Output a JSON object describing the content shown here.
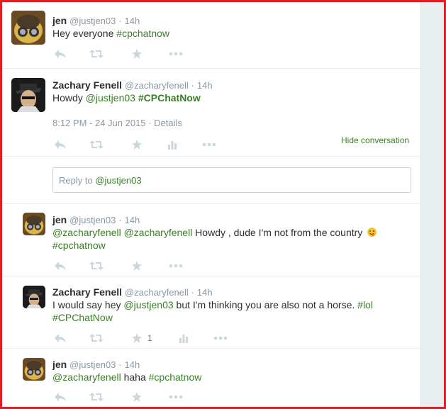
{
  "tweets": [
    {
      "name": "jen",
      "handle": "@justjen03",
      "time": "14h",
      "text_plain": "Hey everyone ",
      "hashtag": "#cpchatnow"
    },
    {
      "name": "Zachary Fenell",
      "handle": "@zacharyfenell",
      "time": "14h",
      "text_plain": "Howdy ",
      "mention": "@justjen03",
      "hashtag": "#CPChatNow",
      "timestamp": "8:12 PM - 24 Jun 2015",
      "details": "Details",
      "hide_conversation": "Hide conversation"
    },
    {
      "name": "jen",
      "handle": "@justjen03",
      "time": "14h",
      "mention1": "@zacharyfenell",
      "mention2": "@zacharyfenell",
      "text_plain": " Howdy , dude I'm not from the country ",
      "hashtag": "#cpchatnow"
    },
    {
      "name": "Zachary Fenell",
      "handle": "@zacharyfenell",
      "time": "14h",
      "text1": "I would say hey ",
      "mention": "@justjen03",
      "text2": " but I'm thinking you are also not a horse. ",
      "hashtag1": "#lol",
      "hashtag2": "#CPChatNow",
      "favorites": "1"
    },
    {
      "name": "jen",
      "handle": "@justjen03",
      "time": "14h",
      "mention": "@zacharyfenell",
      "text_plain": " haha ",
      "hashtag": "#cpchatnow"
    }
  ],
  "reply": {
    "prefix": "Reply to ",
    "user": "@justjen03"
  },
  "separator": "·",
  "icons": [
    "reply-icon",
    "retweet-icon",
    "favorite-icon",
    "more-icon",
    "analytics-icon",
    "wink-emoji-icon"
  ],
  "colors": {
    "link": "#3b7d27",
    "muted": "#8899a6",
    "icon": "#ccd6dd",
    "frame": "#e01e25"
  }
}
